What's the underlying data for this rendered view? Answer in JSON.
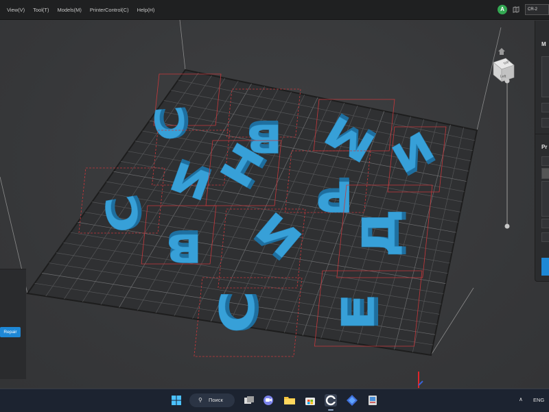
{
  "menu": [
    "View(V)",
    "Tool(T)",
    "Models(M)",
    "PrinterControl(C)",
    "Help(H)"
  ],
  "user": {
    "avatar_letter": "A"
  },
  "printer": {
    "selected": "CR-2"
  },
  "left_panel": {
    "repair_label": "Repair"
  },
  "right_panel": {
    "section1_header": "M",
    "section2_header": "Pr"
  },
  "view_cube": {
    "face_top": "Top",
    "face_left": "Left"
  },
  "taskbar": {
    "search_label": "Поиск",
    "language": "ENG"
  },
  "colors": {
    "model": "#37a0d8",
    "bed": "#2f3032",
    "grid": "#5b5c5e",
    "accent": "#1e88d6"
  }
}
